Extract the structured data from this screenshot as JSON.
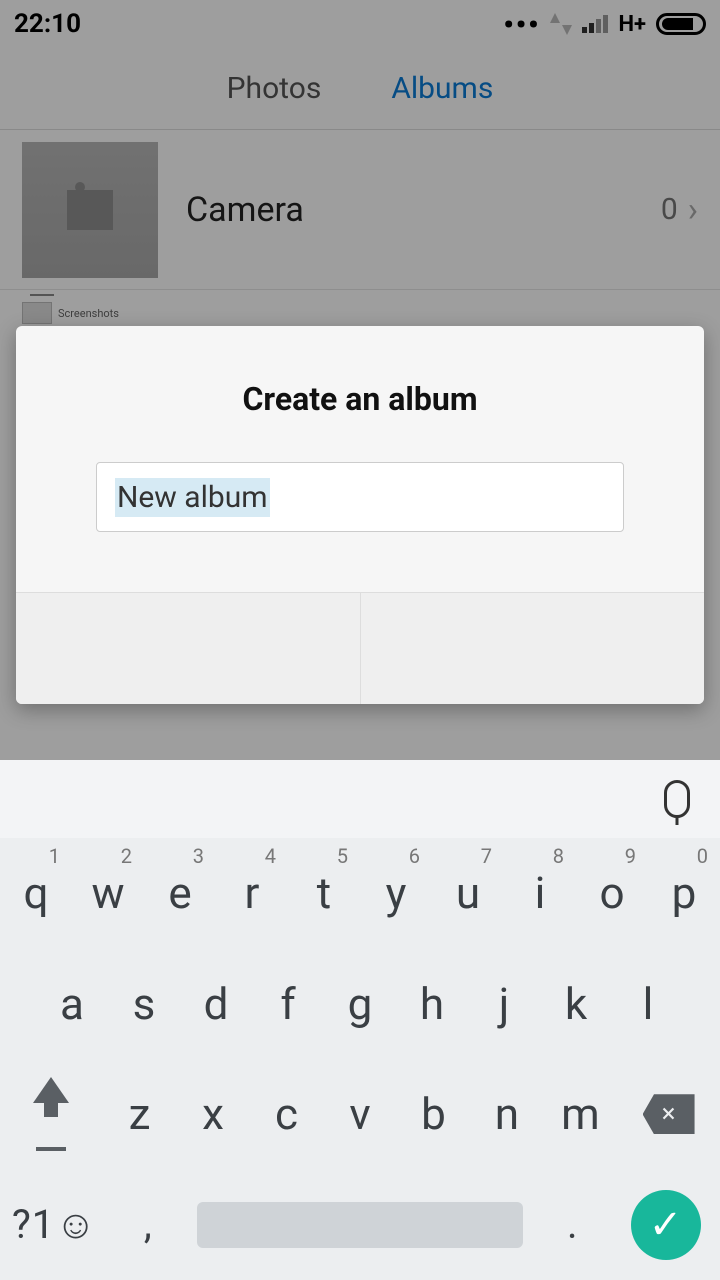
{
  "status": {
    "time": "22:10",
    "network": "H+"
  },
  "tabs": {
    "photos": "Photos",
    "albums": "Albums"
  },
  "albums": [
    {
      "name": "Camera",
      "count": "0"
    },
    {
      "name": "Screenshots"
    }
  ],
  "dialog": {
    "title": "Create an album",
    "input_value": "New album"
  },
  "keyboard": {
    "row1": [
      {
        "k": "q",
        "h": "1"
      },
      {
        "k": "w",
        "h": "2"
      },
      {
        "k": "e",
        "h": "3"
      },
      {
        "k": "r",
        "h": "4"
      },
      {
        "k": "t",
        "h": "5"
      },
      {
        "k": "y",
        "h": "6"
      },
      {
        "k": "u",
        "h": "7"
      },
      {
        "k": "i",
        "h": "8"
      },
      {
        "k": "o",
        "h": "9"
      },
      {
        "k": "p",
        "h": "0"
      }
    ],
    "row2": [
      "a",
      "s",
      "d",
      "f",
      "g",
      "h",
      "j",
      "k",
      "l"
    ],
    "row3": [
      "z",
      "x",
      "c",
      "v",
      "b",
      "n",
      "m"
    ],
    "sym": "?1☺",
    "comma": ",",
    "period": "."
  }
}
